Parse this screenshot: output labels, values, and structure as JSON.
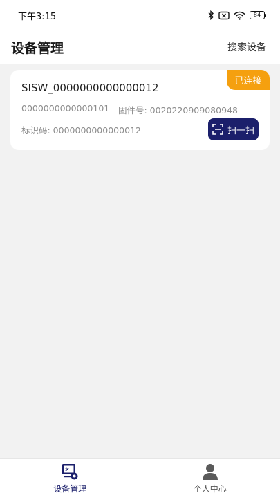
{
  "status_bar": {
    "time": "下午3:15",
    "battery": "84",
    "icons": [
      "bluetooth-icon",
      "no-sim-icon",
      "wifi-icon",
      "battery-icon"
    ]
  },
  "header": {
    "title": "设备管理",
    "search_label": "搜索设备"
  },
  "device": {
    "badge": "已连接",
    "name": "SISW_0000000000000012",
    "serial": "0000000000000101",
    "firmware": "固件号: 0020220909080948",
    "identifier": "标识码: 0000000000000012",
    "scan_label": "扫一扫",
    "badge_color": "#f5a00f",
    "button_color": "#1b1f6b"
  },
  "tabs": [
    {
      "label": "设备管理",
      "icon": "device-manage-icon",
      "active": true
    },
    {
      "label": "个人中心",
      "icon": "person-icon",
      "active": false
    }
  ],
  "colors": {
    "accent": "#1b1f6b",
    "background": "#f2f2f2"
  }
}
